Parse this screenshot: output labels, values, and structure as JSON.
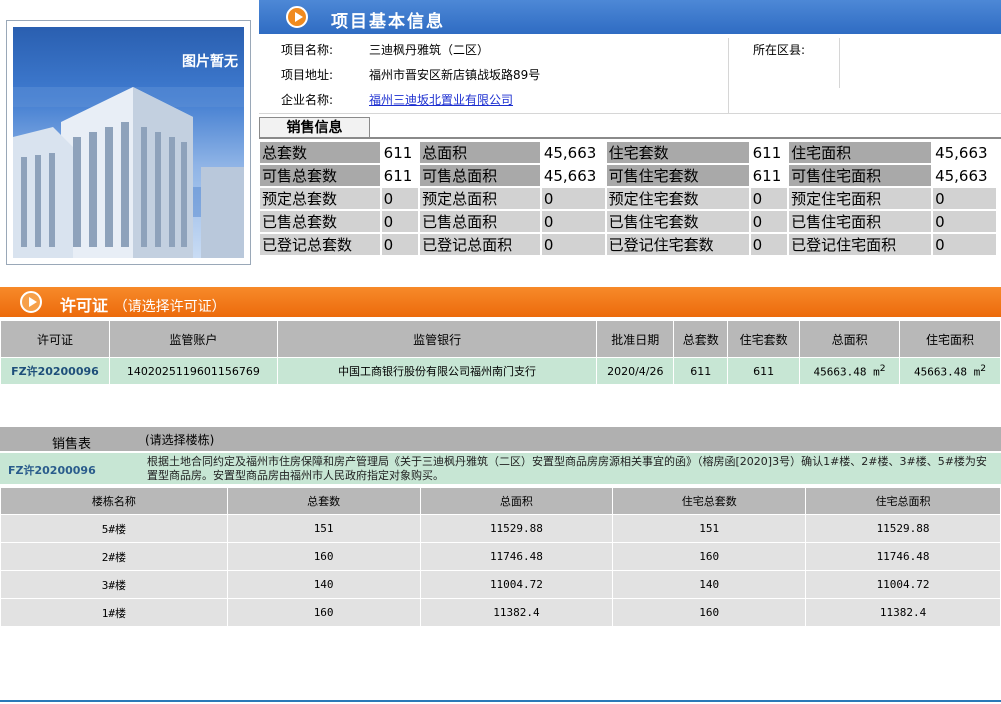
{
  "photo": {
    "placeholder_text": "图片暂无"
  },
  "project_header": {
    "title": "项目基本信息"
  },
  "project_info": {
    "name_label": "项目名称:",
    "name_value": "三迪枫丹雅筑（二区）",
    "district_label": "所在区县:",
    "district_value": "",
    "address_label": "项目地址:",
    "address_value": "福州市晋安区新店镇战坂路89号",
    "company_label": "企业名称:",
    "company_value": "福州三迪坂北置业有限公司"
  },
  "sales_info": {
    "tab_label": "销售信息",
    "rows": [
      [
        {
          "l": "总套数",
          "v": "611"
        },
        {
          "l": "总面积",
          "v": "45,663"
        },
        {
          "l": "住宅套数",
          "v": "611"
        },
        {
          "l": "住宅面积",
          "v": "45,663"
        }
      ],
      [
        {
          "l": "可售总套数",
          "v": "611"
        },
        {
          "l": "可售总面积",
          "v": "45,663"
        },
        {
          "l": "可售住宅套数",
          "v": "611"
        },
        {
          "l": "可售住宅面积",
          "v": "45,663"
        }
      ],
      [
        {
          "l": "预定总套数",
          "v": "0"
        },
        {
          "l": "预定总面积",
          "v": "0"
        },
        {
          "l": "预定住宅套数",
          "v": "0"
        },
        {
          "l": "预定住宅面积",
          "v": "0"
        }
      ],
      [
        {
          "l": "已售总套数",
          "v": "0"
        },
        {
          "l": "已售总面积",
          "v": "0"
        },
        {
          "l": "已售住宅套数",
          "v": "0"
        },
        {
          "l": "已售住宅面积",
          "v": "0"
        }
      ],
      [
        {
          "l": "已登记总套数",
          "v": "0"
        },
        {
          "l": "已登记总面积",
          "v": "0"
        },
        {
          "l": "已登记住宅套数",
          "v": "0"
        },
        {
          "l": "已登记住宅面积",
          "v": "0"
        }
      ]
    ]
  },
  "permit_section": {
    "title": "许可证",
    "subtitle": "（请选择许可证）",
    "headers": [
      "许可证",
      "监管账户",
      "监管银行",
      "批准日期",
      "总套数",
      "住宅套数",
      "总面积",
      "住宅面积"
    ],
    "rows": [
      [
        "FZ许20200096",
        "1402025119601156769",
        "中国工商银行股份有限公司福州南门支行",
        "2020/4/26",
        "611",
        "611",
        "45663.48 m",
        "45663.48 m"
      ]
    ],
    "area_unit_sup": "2"
  },
  "building_section": {
    "title": "销售表",
    "subtitle": "(请选择楼栋)",
    "permit_no": "FZ许20200096",
    "note": "根据土地合同约定及福州市住房保障和房产管理局《关于三迪枫丹雅筑（二区）安置型商品房房源相关事宜的函》（榕房函[2020]3号）确认1#楼、2#楼、3#楼、5#楼为安置型商品房。安置型商品房由福州市人民政府指定对象购买。",
    "headers": [
      "楼栋名称",
      "总套数",
      "总面积",
      "住宅总套数",
      "住宅总面积"
    ],
    "rows": [
      [
        "5#楼",
        "151",
        "11529.88",
        "151",
        "11529.88"
      ],
      [
        "2#楼",
        "160",
        "11746.48",
        "160",
        "11746.48"
      ],
      [
        "3#楼",
        "140",
        "11004.72",
        "140",
        "11004.72"
      ],
      [
        "1#楼",
        "160",
        "11382.4",
        "160",
        "11382.4"
      ]
    ]
  }
}
